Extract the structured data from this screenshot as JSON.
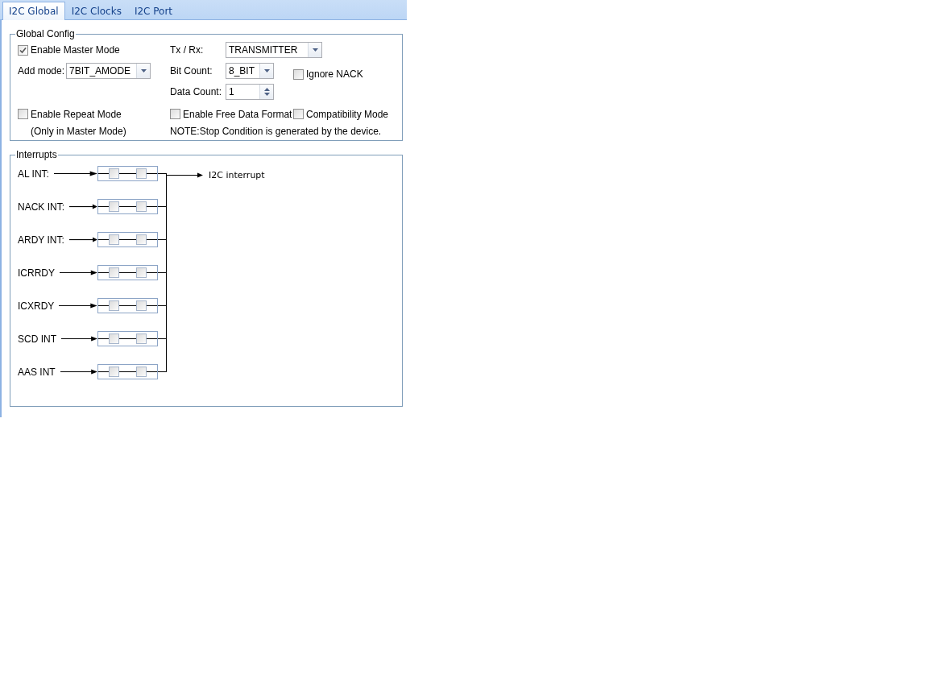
{
  "tabs": [
    {
      "label": "I2C Global",
      "selected": true
    },
    {
      "label": "I2C Clocks",
      "selected": false
    },
    {
      "label": "I2C Port",
      "selected": false
    }
  ],
  "global_config": {
    "title": "Global Config",
    "enable_master_mode": {
      "label": "Enable Master Mode",
      "checked": true
    },
    "add_mode": {
      "label": "Add mode:",
      "value": "7BIT_AMODE"
    },
    "tx_rx": {
      "label": "Tx / Rx:",
      "value": "TRANSMITTER"
    },
    "bit_count": {
      "label": "Bit Count:",
      "value": "8_BIT"
    },
    "ignore_nack": {
      "label": "Ignore NACK",
      "checked": false
    },
    "data_count": {
      "label": "Data Count:",
      "value": "1"
    },
    "enable_repeat_mode": {
      "label": "Enable Repeat Mode",
      "checked": false
    },
    "repeat_note": "(Only in Master Mode)",
    "enable_free_data_format": {
      "label": "Enable Free Data Format",
      "checked": false
    },
    "compatibility_mode": {
      "label": "Compatibility Mode",
      "checked": false
    },
    "note": "NOTE:Stop Condition is generated by the device."
  },
  "interrupts": {
    "title": "Interrupts",
    "output_label": "I2C interrupt",
    "items": [
      {
        "label": "AL INT:",
        "checks": [
          false,
          false
        ]
      },
      {
        "label": "NACK INT:",
        "checks": [
          false,
          false
        ]
      },
      {
        "label": "ARDY INT:",
        "checks": [
          false,
          false
        ]
      },
      {
        "label": "ICRRDY",
        "checks": [
          false,
          false
        ]
      },
      {
        "label": "ICXRDY",
        "checks": [
          false,
          false
        ]
      },
      {
        "label": "SCD INT",
        "checks": [
          false,
          false
        ]
      },
      {
        "label": "AAS INT",
        "checks": [
          false,
          false
        ]
      }
    ]
  }
}
